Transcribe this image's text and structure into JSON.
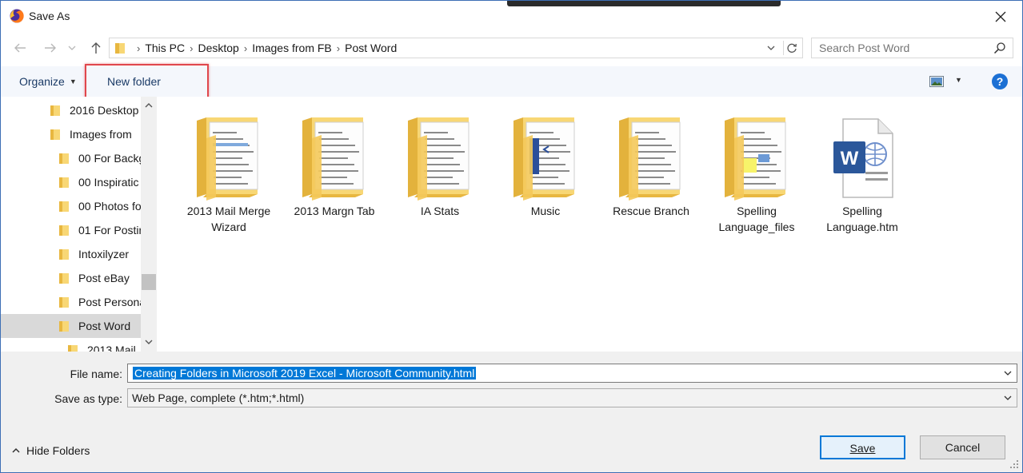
{
  "window": {
    "title": "Save As",
    "app_icon": "firefox-icon"
  },
  "address": {
    "crumbs": [
      "This PC",
      "Desktop",
      "Images from FB",
      "Post Word"
    ]
  },
  "search": {
    "placeholder": "Search Post Word"
  },
  "toolbar": {
    "organize_label": "Organize",
    "new_folder_label": "New folder",
    "help_label": "?"
  },
  "navigation_pane": {
    "items": [
      {
        "label": "2016 Desktop",
        "level": 0,
        "selected": false
      },
      {
        "label": "Images from",
        "level": 0,
        "selected": false
      },
      {
        "label": "00 For Backg",
        "level": 1,
        "selected": false
      },
      {
        "label": "00 Inspiratic",
        "level": 1,
        "selected": false
      },
      {
        "label": "00 Photos fo",
        "level": 1,
        "selected": false
      },
      {
        "label": "01 For Postin",
        "level": 1,
        "selected": false
      },
      {
        "label": "Intoxilyzer",
        "level": 1,
        "selected": false
      },
      {
        "label": "Post eBay",
        "level": 1,
        "selected": false
      },
      {
        "label": "Post Persona",
        "level": 1,
        "selected": false
      },
      {
        "label": "Post Word",
        "level": 1,
        "selected": true
      },
      {
        "label": "2013 Mail",
        "level": 2,
        "selected": false
      }
    ]
  },
  "files": [
    {
      "label_lines": [
        "2013 Mail Merge",
        "Wizard"
      ],
      "kind": "folder"
    },
    {
      "label_lines": [
        "2013 Margn Tab",
        ""
      ],
      "kind": "folder"
    },
    {
      "label_lines": [
        "IA Stats",
        ""
      ],
      "kind": "folder"
    },
    {
      "label_lines": [
        "Music",
        ""
      ],
      "kind": "folder"
    },
    {
      "label_lines": [
        "Rescue Branch",
        ""
      ],
      "kind": "folder"
    },
    {
      "label_lines": [
        "Spelling",
        "Language_files"
      ],
      "kind": "folder"
    },
    {
      "label_lines": [
        "Spelling",
        "Language.htm"
      ],
      "kind": "word-doc"
    }
  ],
  "form": {
    "file_name_label": "File name:",
    "file_name_value": "Creating Folders in Microsoft 2019 Excel - Microsoft Community.html",
    "save_type_label": "Save as type:",
    "save_type_value": "Web Page, complete (*.htm;*.html)"
  },
  "footer": {
    "hide_folders_label": "Hide Folders",
    "save_label": "Save",
    "cancel_label": "Cancel"
  },
  "colors": {
    "accent": "#0078d7",
    "highlight_box": "#e0474c",
    "folder": "#f8d775",
    "word_blue": "#2b579a"
  }
}
